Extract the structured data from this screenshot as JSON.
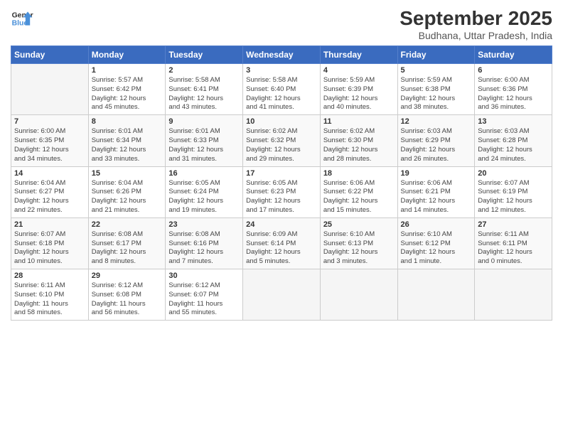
{
  "logo": {
    "line1": "General",
    "line2": "Blue"
  },
  "title": "September 2025",
  "subtitle": "Budhana, Uttar Pradesh, India",
  "days_of_week": [
    "Sunday",
    "Monday",
    "Tuesday",
    "Wednesday",
    "Thursday",
    "Friday",
    "Saturday"
  ],
  "weeks": [
    [
      {
        "num": "",
        "info": ""
      },
      {
        "num": "1",
        "info": "Sunrise: 5:57 AM\nSunset: 6:42 PM\nDaylight: 12 hours\nand 45 minutes."
      },
      {
        "num": "2",
        "info": "Sunrise: 5:58 AM\nSunset: 6:41 PM\nDaylight: 12 hours\nand 43 minutes."
      },
      {
        "num": "3",
        "info": "Sunrise: 5:58 AM\nSunset: 6:40 PM\nDaylight: 12 hours\nand 41 minutes."
      },
      {
        "num": "4",
        "info": "Sunrise: 5:59 AM\nSunset: 6:39 PM\nDaylight: 12 hours\nand 40 minutes."
      },
      {
        "num": "5",
        "info": "Sunrise: 5:59 AM\nSunset: 6:38 PM\nDaylight: 12 hours\nand 38 minutes."
      },
      {
        "num": "6",
        "info": "Sunrise: 6:00 AM\nSunset: 6:36 PM\nDaylight: 12 hours\nand 36 minutes."
      }
    ],
    [
      {
        "num": "7",
        "info": "Sunrise: 6:00 AM\nSunset: 6:35 PM\nDaylight: 12 hours\nand 34 minutes."
      },
      {
        "num": "8",
        "info": "Sunrise: 6:01 AM\nSunset: 6:34 PM\nDaylight: 12 hours\nand 33 minutes."
      },
      {
        "num": "9",
        "info": "Sunrise: 6:01 AM\nSunset: 6:33 PM\nDaylight: 12 hours\nand 31 minutes."
      },
      {
        "num": "10",
        "info": "Sunrise: 6:02 AM\nSunset: 6:32 PM\nDaylight: 12 hours\nand 29 minutes."
      },
      {
        "num": "11",
        "info": "Sunrise: 6:02 AM\nSunset: 6:30 PM\nDaylight: 12 hours\nand 28 minutes."
      },
      {
        "num": "12",
        "info": "Sunrise: 6:03 AM\nSunset: 6:29 PM\nDaylight: 12 hours\nand 26 minutes."
      },
      {
        "num": "13",
        "info": "Sunrise: 6:03 AM\nSunset: 6:28 PM\nDaylight: 12 hours\nand 24 minutes."
      }
    ],
    [
      {
        "num": "14",
        "info": "Sunrise: 6:04 AM\nSunset: 6:27 PM\nDaylight: 12 hours\nand 22 minutes."
      },
      {
        "num": "15",
        "info": "Sunrise: 6:04 AM\nSunset: 6:26 PM\nDaylight: 12 hours\nand 21 minutes."
      },
      {
        "num": "16",
        "info": "Sunrise: 6:05 AM\nSunset: 6:24 PM\nDaylight: 12 hours\nand 19 minutes."
      },
      {
        "num": "17",
        "info": "Sunrise: 6:05 AM\nSunset: 6:23 PM\nDaylight: 12 hours\nand 17 minutes."
      },
      {
        "num": "18",
        "info": "Sunrise: 6:06 AM\nSunset: 6:22 PM\nDaylight: 12 hours\nand 15 minutes."
      },
      {
        "num": "19",
        "info": "Sunrise: 6:06 AM\nSunset: 6:21 PM\nDaylight: 12 hours\nand 14 minutes."
      },
      {
        "num": "20",
        "info": "Sunrise: 6:07 AM\nSunset: 6:19 PM\nDaylight: 12 hours\nand 12 minutes."
      }
    ],
    [
      {
        "num": "21",
        "info": "Sunrise: 6:07 AM\nSunset: 6:18 PM\nDaylight: 12 hours\nand 10 minutes."
      },
      {
        "num": "22",
        "info": "Sunrise: 6:08 AM\nSunset: 6:17 PM\nDaylight: 12 hours\nand 8 minutes."
      },
      {
        "num": "23",
        "info": "Sunrise: 6:08 AM\nSunset: 6:16 PM\nDaylight: 12 hours\nand 7 minutes."
      },
      {
        "num": "24",
        "info": "Sunrise: 6:09 AM\nSunset: 6:14 PM\nDaylight: 12 hours\nand 5 minutes."
      },
      {
        "num": "25",
        "info": "Sunrise: 6:10 AM\nSunset: 6:13 PM\nDaylight: 12 hours\nand 3 minutes."
      },
      {
        "num": "26",
        "info": "Sunrise: 6:10 AM\nSunset: 6:12 PM\nDaylight: 12 hours\nand 1 minute."
      },
      {
        "num": "27",
        "info": "Sunrise: 6:11 AM\nSunset: 6:11 PM\nDaylight: 12 hours\nand 0 minutes."
      }
    ],
    [
      {
        "num": "28",
        "info": "Sunrise: 6:11 AM\nSunset: 6:10 PM\nDaylight: 11 hours\nand 58 minutes."
      },
      {
        "num": "29",
        "info": "Sunrise: 6:12 AM\nSunset: 6:08 PM\nDaylight: 11 hours\nand 56 minutes."
      },
      {
        "num": "30",
        "info": "Sunrise: 6:12 AM\nSunset: 6:07 PM\nDaylight: 11 hours\nand 55 minutes."
      },
      {
        "num": "",
        "info": ""
      },
      {
        "num": "",
        "info": ""
      },
      {
        "num": "",
        "info": ""
      },
      {
        "num": "",
        "info": ""
      }
    ]
  ]
}
